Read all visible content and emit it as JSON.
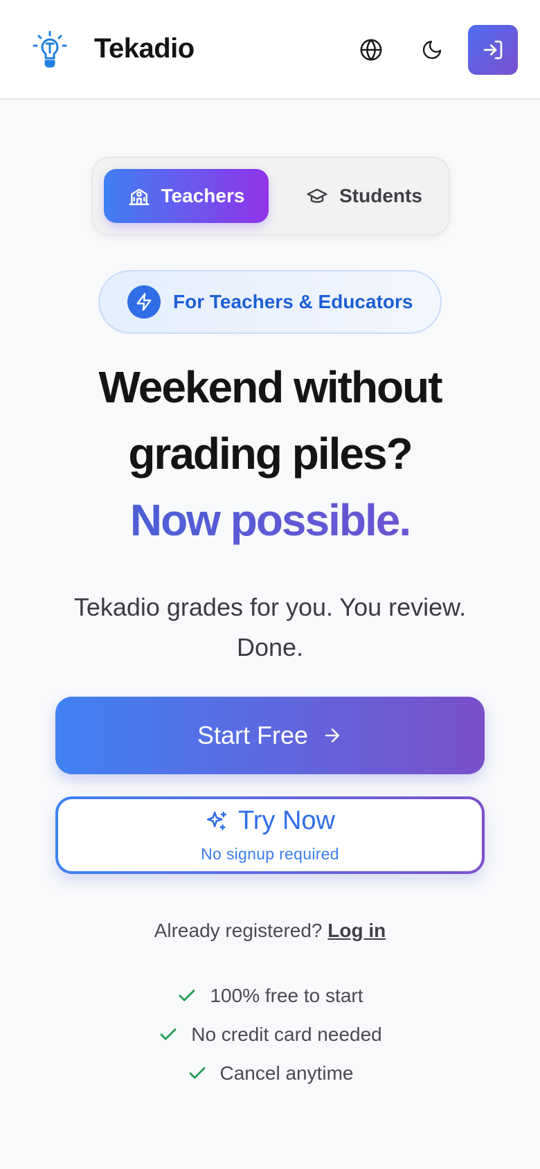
{
  "header": {
    "brand": "Tekadio",
    "logo_icon": "lightbulb-icon",
    "language_icon": "globe-icon",
    "theme_icon": "moon-icon",
    "login_icon": "log-in-icon",
    "accent_gradient": [
      "#4f6df0",
      "#7a4fce"
    ]
  },
  "audience_toggle": {
    "tabs": [
      {
        "label": "Teachers",
        "icon": "school-icon",
        "selected": true
      },
      {
        "label": "Students",
        "icon": "graduation-cap-icon",
        "selected": false
      }
    ]
  },
  "badge": {
    "icon": "lightning-icon",
    "text": "For Teachers & Educators"
  },
  "hero": {
    "headline_line1": "Weekend without",
    "headline_line2": "grading piles?",
    "headline_highlight": "Now possible.",
    "subtitle": "Tekadio grades for you. You review. Done."
  },
  "cta": {
    "primary_label": "Start Free",
    "primary_icon": "arrow-right-icon",
    "secondary_label": "Try Now",
    "secondary_icon": "sparkles-icon",
    "secondary_sublabel": "No signup required"
  },
  "login_prompt": {
    "text": "Already registered?",
    "link": "Log in"
  },
  "features": [
    {
      "icon": "check-icon",
      "text": "100% free to start"
    },
    {
      "icon": "check-icon",
      "text": "No credit card needed"
    },
    {
      "icon": "check-icon",
      "text": "Cancel anytime"
    }
  ],
  "colors": {
    "check": "#1f9d4f",
    "brand_blue": "#2f6ee6",
    "background": "#f8f9fb"
  }
}
